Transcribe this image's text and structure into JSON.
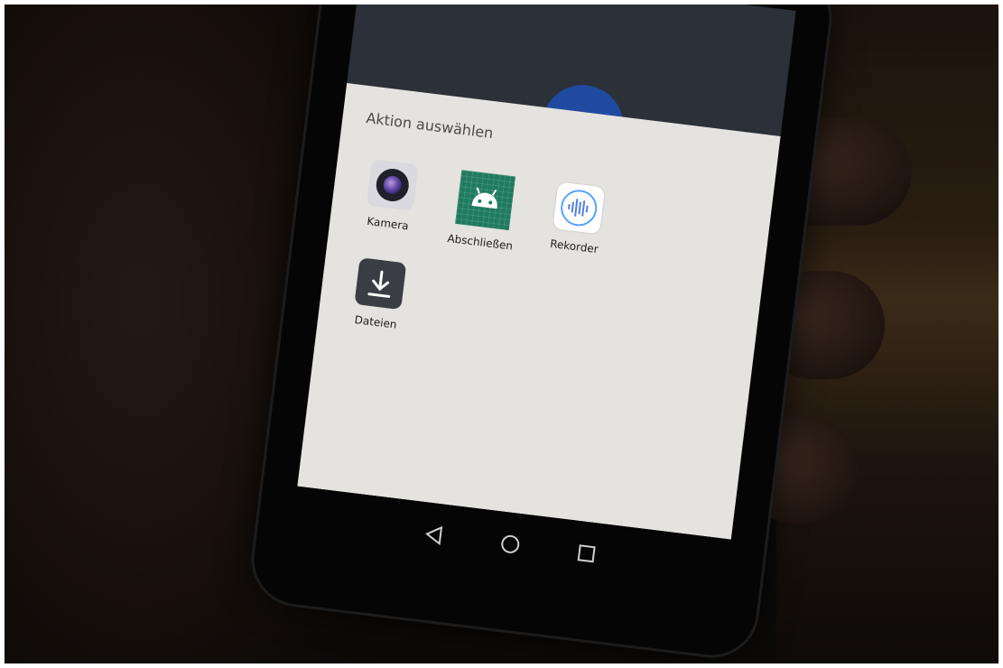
{
  "dialog": {
    "title": "Aktion auswählen"
  },
  "apps": [
    {
      "label": "Kamera",
      "icon": "camera-icon"
    },
    {
      "label": "Abschließen",
      "icon": "android-lock-icon"
    },
    {
      "label": "Rekorder",
      "icon": "recorder-wave-icon"
    },
    {
      "label": "Dateien",
      "icon": "download-icon"
    }
  ],
  "navigation": {
    "back": "back-triangle-icon",
    "home": "home-circle-icon",
    "recents": "recents-square-icon"
  },
  "colors": {
    "sheet": "#e4e3df",
    "fab": "#1f4aa0",
    "android_tile": "#1f7a5e",
    "recorder_accent": "#56a3ff"
  }
}
